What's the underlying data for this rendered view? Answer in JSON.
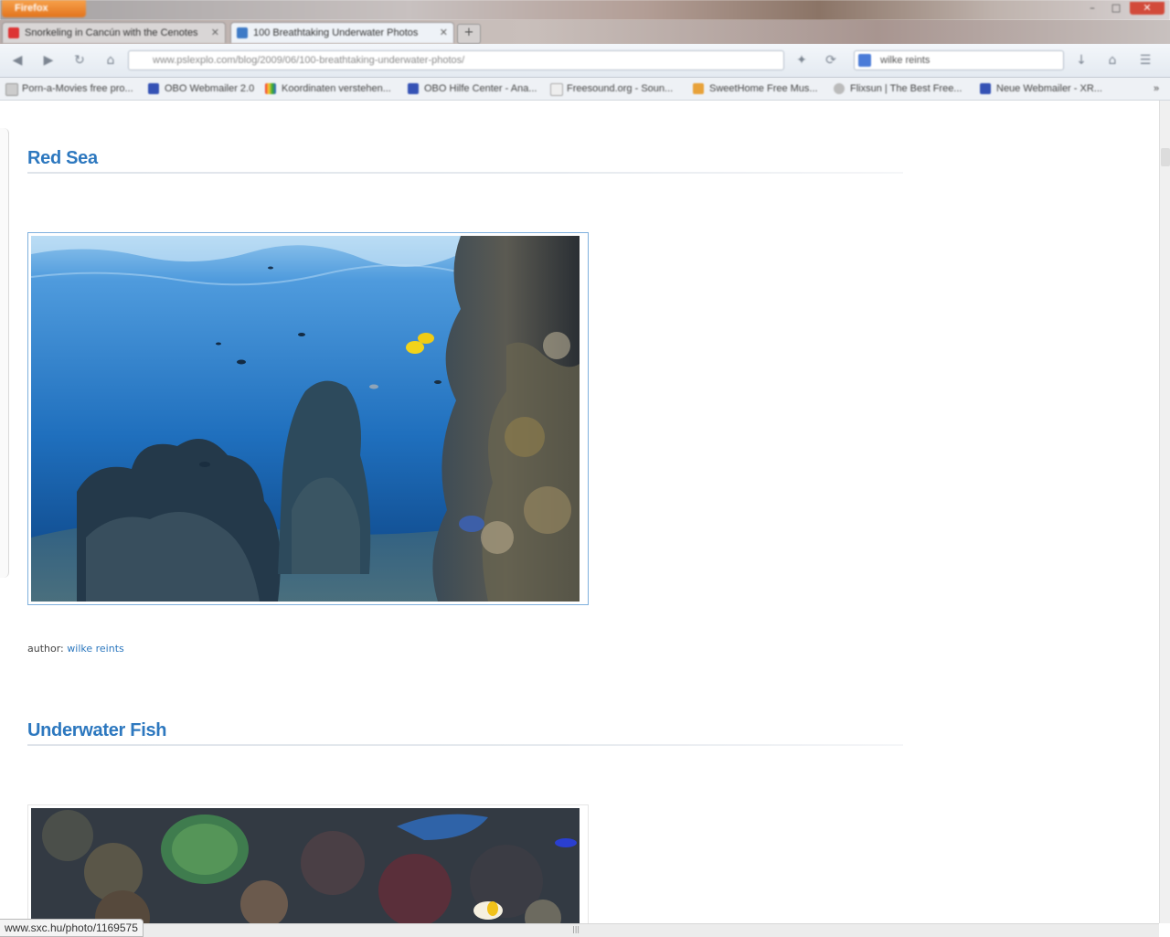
{
  "browser": {
    "app_button_label": "Firefox",
    "window_controls": [
      "–",
      "□",
      "✕"
    ],
    "tabs": [
      {
        "label": "Snorkeling in Cancún with the Cenotes",
        "active": false
      },
      {
        "label": "100 Breathtaking Underwater Photos",
        "active": true
      }
    ],
    "new_tab_label": "+",
    "url": "www.pslexplo.com/blog/2009/06/100-breathtaking-underwater-photos/",
    "search_query": "wilke reints",
    "bookmarks": [
      "Porn-a-Movies free pro...",
      "OBO Webmailer 2.0",
      "Koordinaten verstehen...",
      "OBO Hilfe Center - Ana...",
      "Freesound.org - Soun...",
      "SweetHome Free Mus...",
      "Flixsun | The Best Free...",
      "Neue Webmailer - XR..."
    ]
  },
  "page": {
    "sections": [
      {
        "title": "Red Sea",
        "author_prefix": "author: ",
        "author_name": "wilke reints"
      },
      {
        "title": "Underwater Fish"
      }
    ]
  },
  "status_bar": {
    "link_url": "www.sxc.hu/photo/1169575",
    "grip": "|||"
  },
  "colors": {
    "accent": "#2d78bf",
    "frame_border": "#7fb0dd"
  }
}
